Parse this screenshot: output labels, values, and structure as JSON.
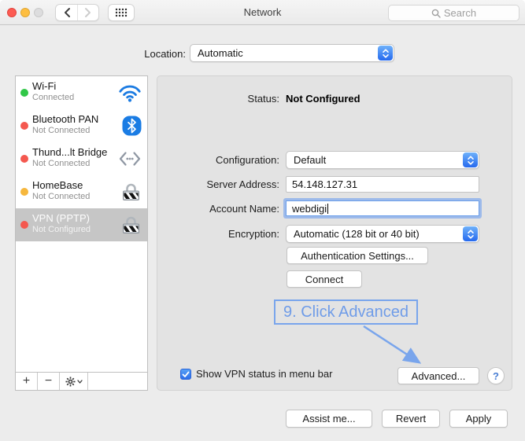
{
  "window": {
    "title": "Network"
  },
  "titlebar": {
    "search_placeholder": "Search",
    "icons": [
      "close-icon",
      "minimize-icon",
      "zoom-icon",
      "back-icon",
      "forward-icon",
      "show-all-grid-icon",
      "search-icon"
    ]
  },
  "location": {
    "label": "Location:",
    "value": "Automatic"
  },
  "sidebar": {
    "items": [
      {
        "name": "Wi-Fi",
        "status": "Connected",
        "dot": "#31c748",
        "icon": "wifi-icon",
        "selected": false
      },
      {
        "name": "Bluetooth PAN",
        "status": "Not Connected",
        "dot": "#f4584f",
        "icon": "bluetooth-icon",
        "selected": false
      },
      {
        "name": "Thund...lt Bridge",
        "status": "Not Connected",
        "dot": "#f4584f",
        "icon": "thunderbolt-bridge-icon",
        "selected": false
      },
      {
        "name": "HomeBase",
        "status": "Not Connected",
        "dot": "#f6b73d",
        "icon": "vpn-lock-icon",
        "selected": false
      },
      {
        "name": "VPN (PPTP)",
        "status": "Not Configured",
        "dot": "#f4584f",
        "icon": "vpn-lock-icon",
        "selected": true
      }
    ],
    "footer": {
      "add": "+",
      "remove": "−",
      "action_icon": "gear-icon"
    }
  },
  "panel": {
    "status_label": "Status:",
    "status_value": "Not Configured",
    "configuration": {
      "label": "Configuration:",
      "value": "Default"
    },
    "server_address": {
      "label": "Server Address:",
      "value": "54.148.127.31"
    },
    "account_name": {
      "label": "Account Name:",
      "value": "webdigi"
    },
    "encryption": {
      "label": "Encryption:",
      "value": "Automatic (128 bit or 40 bit)"
    },
    "auth_button": "Authentication Settings...",
    "connect_button": "Connect",
    "annotation": "9. Click Advanced",
    "checkbox_label": "Show VPN status in menu bar",
    "checkbox_checked": true,
    "advanced_button": "Advanced...",
    "help_button": "?"
  },
  "footer": {
    "assist_button": "Assist me...",
    "revert_button": "Revert",
    "apply_button": "Apply"
  },
  "colors": {
    "accent_blue": "#2f7cf6",
    "annotation_blue": "#79a5ec",
    "selected_row": "#c6c6c6"
  }
}
